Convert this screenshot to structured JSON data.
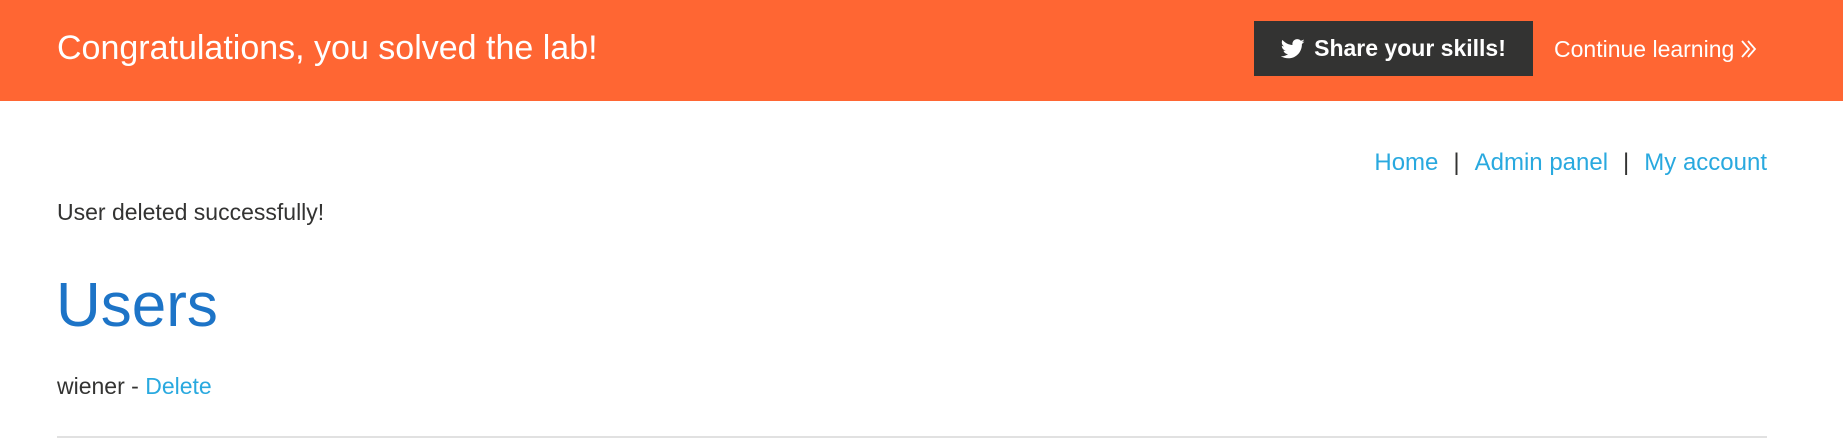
{
  "banner": {
    "title": "Congratulations, you solved the lab!",
    "share_label": "Share your skills!",
    "share_icon": "twitter-icon",
    "continue_label": "Continue learning",
    "continue_icon": "double-chevron-right-icon",
    "background_color": "#ff6633"
  },
  "nav": {
    "home": "Home",
    "admin_panel": "Admin panel",
    "my_account": "My account",
    "separator": "|"
  },
  "message": "User deleted successfully!",
  "page": {
    "title": "Users"
  },
  "users": [
    {
      "name": "wiener",
      "separator": " - ",
      "action_label": "Delete"
    }
  ],
  "colors": {
    "link": "#29a9df",
    "heading": "#1d74c7",
    "text": "#333332",
    "button_dark": "#333332"
  }
}
